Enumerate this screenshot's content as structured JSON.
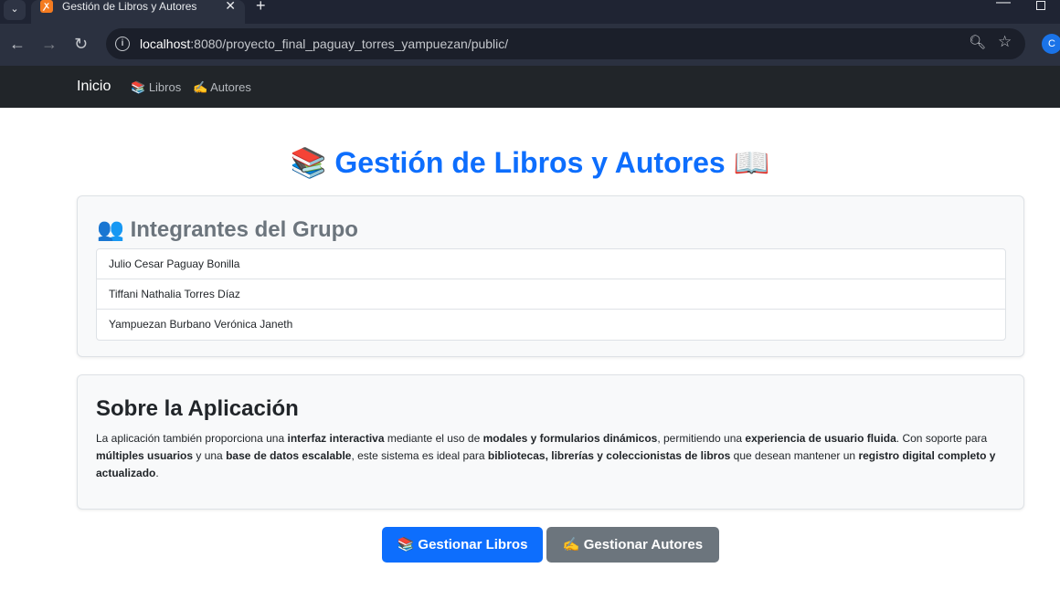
{
  "browser": {
    "tab_title": "Gestión de Libros y Autores",
    "tab_favicon": "xampp-icon",
    "url_host": "localhost",
    "url_rest": ":8080/proyecto_final_paguay_torres_yampuezan/public/",
    "profile_initial": "C"
  },
  "navbar": {
    "brand": "Inicio",
    "links": [
      {
        "icon": "📚",
        "label": "Libros"
      },
      {
        "icon": "✍️",
        "label": "Autores"
      }
    ]
  },
  "main": {
    "title_icon_left": "📚",
    "title": "Gestión de Libros y Autores",
    "title_icon_right": "📖"
  },
  "team": {
    "icon": "👥",
    "title": "Integrantes del Grupo",
    "members": [
      "Julio Cesar Paguay Bonilla",
      "Tiffani Nathalia Torres Díaz",
      "Yampuezan Burbano Verónica Janeth"
    ]
  },
  "about": {
    "title": "Sobre la Aplicación",
    "segments": [
      {
        "t": "La aplicación también proporciona una ",
        "b": false
      },
      {
        "t": "interfaz interactiva",
        "b": true
      },
      {
        "t": " mediante el uso de ",
        "b": false
      },
      {
        "t": "modales y formularios dinámicos",
        "b": true
      },
      {
        "t": ", permitiendo una ",
        "b": false
      },
      {
        "t": "experiencia de usuario fluida",
        "b": true
      },
      {
        "t": ". Con soporte para ",
        "b": false
      },
      {
        "t": "múltiples usuarios",
        "b": true
      },
      {
        "t": " y una ",
        "b": false
      },
      {
        "t": "base de datos escalable",
        "b": true
      },
      {
        "t": ", este sistema es ideal para ",
        "b": false
      },
      {
        "t": "bibliotecas, librerías y coleccionistas de libros",
        "b": true
      },
      {
        "t": " que desean mantener un ",
        "b": false
      },
      {
        "t": "registro digital completo y actualizado",
        "b": true
      },
      {
        "t": ".",
        "b": false
      }
    ]
  },
  "buttons": {
    "books": {
      "icon": "📚",
      "label": "Gestionar Libros",
      "color": "#0d6efd"
    },
    "authors": {
      "icon": "✍️",
      "label": "Gestionar Autores",
      "color": "#6c757d"
    }
  }
}
